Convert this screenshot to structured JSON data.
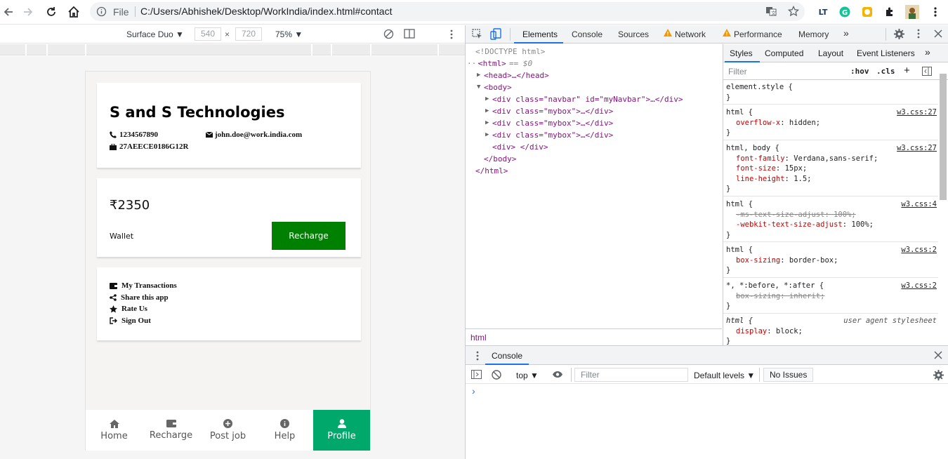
{
  "browser": {
    "file_label": "File",
    "url": "C:/Users/Abhishek/Desktop/WorkIndia/index.html#contact"
  },
  "device_toolbar": {
    "device": "Surface Duo",
    "width": "540",
    "x_sep": "×",
    "height": "720",
    "zoom": "75%"
  },
  "app": {
    "company_name": "S and S Technologies",
    "phone": "1234567890",
    "email": "john.doe@work.india.com",
    "gst": "27AEECE0186G12R",
    "balance": "₹2350",
    "wallet_label": "Wallet",
    "recharge_button": "Recharge",
    "menu": [
      {
        "icon": "wallet-icon",
        "label": "My Transactions"
      },
      {
        "icon": "share-icon",
        "label": "Share this app"
      },
      {
        "icon": "star-icon",
        "label": "Rate Us"
      },
      {
        "icon": "sign-out-icon",
        "label": "Sign Out"
      }
    ],
    "nav": [
      {
        "icon": "home-icon",
        "label": "Home"
      },
      {
        "icon": "wallet-icon",
        "label": "Recharge"
      },
      {
        "icon": "plus-circle-icon",
        "label": "Post job"
      },
      {
        "icon": "info-icon",
        "label": "Help"
      },
      {
        "icon": "user-icon",
        "label": "Profile"
      }
    ],
    "active_nav": "Profile",
    "accent_green": "#008000",
    "active_nav_color": "#00a86b"
  },
  "devtools": {
    "tabs": [
      "Elements",
      "Console",
      "Sources",
      "Network",
      "Performance",
      "Memory"
    ],
    "more": "»",
    "dom": {
      "doctype": "<!DOCTYPE html>",
      "html_open": "<html>",
      "selected_marker": "== $0",
      "head": "<head>…</head>",
      "body_open": "<body>",
      "navbar_div": "<div class=\"navbar\" id=\"myNavbar\">…</div>",
      "mybox_div": "<div class=\"mybox\">…</div>",
      "empty_div": "<div> </div>",
      "body_close": "</body>",
      "html_close": "</html>"
    },
    "breadcrumb": "html",
    "styles_tabs": [
      "Styles",
      "Computed",
      "Layout",
      "Event Listeners"
    ],
    "filter_placeholder": "Filter",
    "hov": ":hov",
    "cls": ".cls",
    "rules": [
      {
        "selector": "element.style {",
        "source": "",
        "props": [],
        "close": "}"
      },
      {
        "selector": "html {",
        "source": "w3.css:27",
        "props": [
          {
            "n": "overflow-x",
            "v": "hidden;"
          }
        ],
        "close": "}"
      },
      {
        "selector": "html, body {",
        "source": "w3.css:27",
        "props": [
          {
            "n": "font-family",
            "v": "Verdana,sans-serif;"
          },
          {
            "n": "font-size",
            "v": "15px;"
          },
          {
            "n": "line-height",
            "v": "1.5;"
          }
        ],
        "close": "}"
      },
      {
        "selector": "html {",
        "source": "w3.css:4",
        "props": [
          {
            "n": "-ms-text-size-adjust",
            "v": "100%;"
          },
          {
            "n": "-webkit-text-size-adjust",
            "v": "100%;"
          }
        ],
        "close": "}"
      },
      {
        "selector": "html {",
        "source": "w3.css:2",
        "props": [
          {
            "n": "box-sizing",
            "v": "border-box;"
          }
        ],
        "close": "}"
      },
      {
        "selector": "*, *:before, *:after {",
        "source": "w3.css:2",
        "props": [
          {
            "n": "box-sizing",
            "v": "inherit;"
          }
        ],
        "close": "}"
      },
      {
        "selector": "html {",
        "source": "user agent stylesheet",
        "props": [
          {
            "n": "display",
            "v": "block;"
          }
        ],
        "close": "}"
      }
    ],
    "drawer_tab": "Console",
    "context": "top",
    "console_filter": "Filter",
    "levels": "Default levels",
    "issues": "No Issues",
    "prompt": "›"
  }
}
